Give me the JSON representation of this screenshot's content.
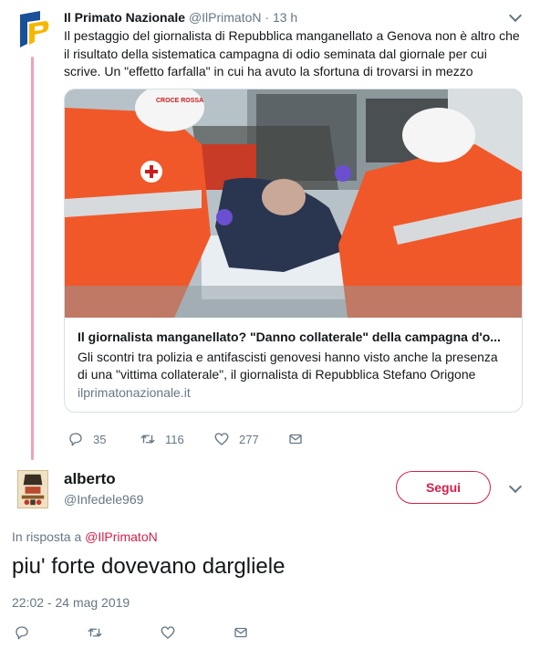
{
  "parent_tweet": {
    "author_name": "Il Primato Nazionale",
    "author_handle": "@IlPrimatoN",
    "separator": "·",
    "time": "13 h",
    "text": "Il pestaggio del giornalista di Repubblica manganellato a Genova non è altro che il risultato della sistematica campagna di odio seminata dal giornale per cui scrive. Un \"effetto farfalla\" in cui ha avuto la sfortuna di trovarsi in mezzo",
    "card": {
      "title": "Il giornalista manganellato? \"Danno collaterale\" della campagna d'o...",
      "description": "Gli scontri tra polizia e antifascisti genovesi hanno visto anche la presenza di una \"vittima collaterale\", il giornalista di Repubblica Stefano Origone",
      "domain": "ilprimatonazionale.it",
      "image_text": "CROCE ROSSA"
    },
    "actions": {
      "replies": "35",
      "retweets": "116",
      "likes": "277"
    }
  },
  "reply_tweet": {
    "author_name": "alberto",
    "author_handle": "@Infedele969",
    "follow_label": "Segui",
    "in_reply_prefix": "In risposta a ",
    "in_reply_handle": "@IlPrimatoN",
    "text": "piu' forte dovevano dargliele",
    "timestamp": "22:02 - 24 mag 2019"
  },
  "icons": {
    "reply": "reply-icon",
    "retweet": "retweet-icon",
    "like": "heart-icon",
    "message": "envelope-icon",
    "more": "chevron-down-icon"
  },
  "colors": {
    "accent": "#d61f4b",
    "muted": "#657786",
    "thread_line": "#f0a1bd",
    "brand_yellow": "#f5b800",
    "brand_blue": "#1a4f99"
  }
}
